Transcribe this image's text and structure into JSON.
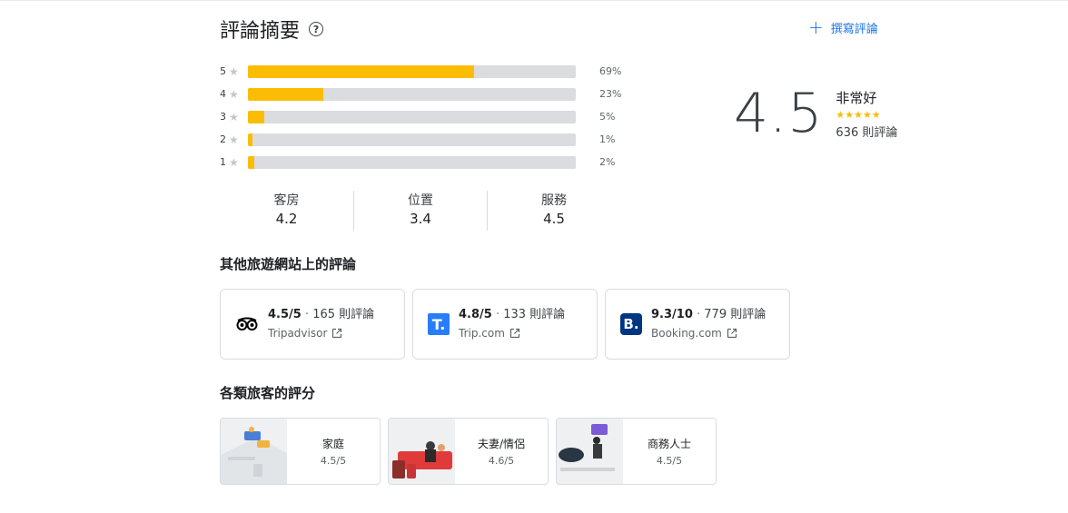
{
  "summary": {
    "title": "評論摘要",
    "help_icon": "?",
    "write_review_label": "撰寫評論"
  },
  "distribution": [
    {
      "star": "5",
      "pct_label": "69%",
      "value": 69
    },
    {
      "star": "4",
      "pct_label": "23%",
      "value": 23
    },
    {
      "star": "3",
      "pct_label": "5%",
      "value": 5
    },
    {
      "star": "2",
      "pct_label": "1%",
      "value": 1
    },
    {
      "star": "1",
      "pct_label": "2%",
      "value": 2
    }
  ],
  "overall": {
    "score": "4.5",
    "label": "非常好",
    "stars": "★★★★★",
    "star_value": 4.5,
    "count": "636 則評論"
  },
  "categories": [
    {
      "name": "客房",
      "score": "4.2"
    },
    {
      "name": "位置",
      "score": "3.4"
    },
    {
      "name": "服務",
      "score": "4.5"
    }
  ],
  "other_sites": {
    "title": "其他旅遊網站上的評論",
    "items": [
      {
        "score": "4.5/5",
        "sep": " · ",
        "count": "165 則評論",
        "name": "Tripadvisor",
        "icon": "tripadvisor-owl-icon"
      },
      {
        "score": "4.8/5",
        "sep": " · ",
        "count": "133 則評論",
        "name": "Trip.com",
        "icon": "tripcom-logo-icon",
        "logo_text": "T."
      },
      {
        "score": "9.3/10",
        "sep": " · ",
        "count": "779 則評論",
        "name": "Booking.com",
        "icon": "booking-logo-icon",
        "logo_text": "B."
      }
    ]
  },
  "traveler_types": {
    "title": "各類旅客的評分",
    "items": [
      {
        "name": "家庭",
        "score": "4.5/5",
        "icon": "family-illustration"
      },
      {
        "name": "夫妻/情侶",
        "score": "4.6/5",
        "icon": "couple-illustration"
      },
      {
        "name": "商務人士",
        "score": "4.5/5",
        "icon": "business-illustration"
      }
    ]
  },
  "colors": {
    "accent_blue": "#1a73e8",
    "bar_fill": "#fbbc04",
    "bar_track": "#dadce0"
  }
}
